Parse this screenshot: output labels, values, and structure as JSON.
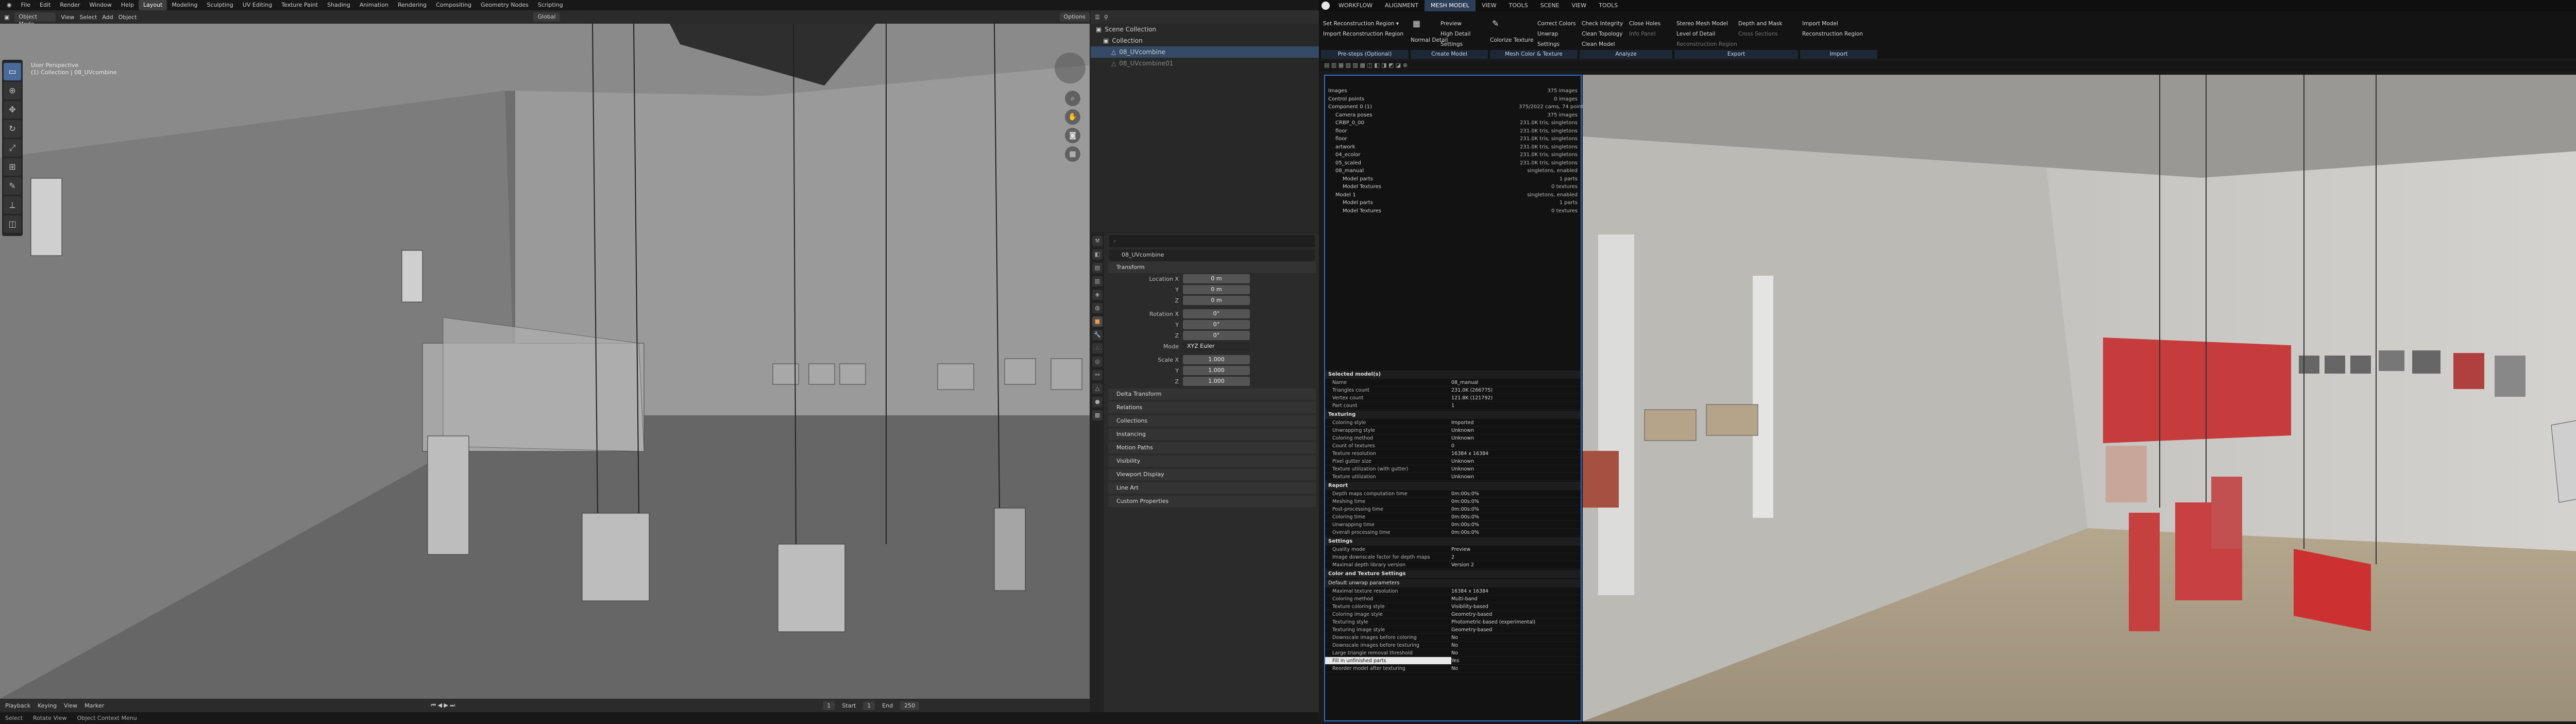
{
  "blender": {
    "topbar": {
      "menus": [
        "File",
        "Edit",
        "Render",
        "Window",
        "Help"
      ],
      "workspaces": [
        "Layout",
        "Modeling",
        "Sculpting",
        "UV Editing",
        "Texture Paint",
        "Shading",
        "Animation",
        "Rendering",
        "Compositing",
        "Geometry Nodes",
        "Scripting"
      ],
      "active_workspace": "Layout"
    },
    "viewport": {
      "orientation": "Global",
      "mode": "Object Mode",
      "menus": [
        "View",
        "Select",
        "Add",
        "Object"
      ],
      "options": "Options",
      "info_line1": "User Perspective",
      "info_line2": "(1) Collection | 08_UVcombine"
    },
    "timeline": {
      "menus": [
        "Playback",
        "Keying",
        "View",
        "Marker"
      ],
      "current_frame": "1",
      "start_label": "Start",
      "start": "1",
      "end_label": "End",
      "end": "250"
    },
    "statusbar": [
      "Select",
      "Rotate View",
      "Object Context Menu"
    ],
    "outliner": {
      "rows": [
        "Scene Collection",
        "Collection",
        "08_UVcombine",
        "08_UVcombine01"
      ]
    },
    "properties": {
      "object_name": "08_UVcombine",
      "transform": "Transform",
      "location_label": "Location X",
      "location": [
        "0 m",
        "0 m",
        "0 m"
      ],
      "rotation_label": "Rotation X",
      "rotation": [
        "0°",
        "0°",
        "0°"
      ],
      "mode_label": "Mode",
      "mode": "XYZ Euler",
      "scale_label": "Scale X",
      "scale": [
        "1.000",
        "1.000",
        "1.000"
      ],
      "axis": [
        "Y",
        "Z"
      ],
      "panels": [
        "Delta Transform",
        "Relations",
        "Collections",
        "Instancing",
        "Motion Paths",
        "Visibility",
        "Viewport Display",
        "Line Art",
        "Custom Properties"
      ]
    }
  },
  "rc": {
    "menubar": [
      "WORKFLOW",
      "ALIGNMENT",
      "MESH MODEL",
      "VIEW",
      "TOOLS",
      "SCENE",
      "VIEW",
      "TOOLS"
    ],
    "active_tab": "MESH MODEL",
    "ribbon": {
      "pre": {
        "items": [
          "Set Reconstruction Region ▾",
          "Import Reconstruction Region"
        ],
        "label": "Pre-steps (Optional)"
      },
      "create": {
        "items": [
          "Normal Detail",
          "Preview",
          "High Detail",
          "Settings"
        ],
        "label": "Create Model"
      },
      "mesh": {
        "items": [
          "Colorize",
          "Texture",
          "Correct Colors",
          "Unwrap",
          "Settings"
        ],
        "label": "Mesh Color & Texture"
      },
      "analyze": {
        "items": [
          "Check Integrity",
          "Close Holes",
          "Clean Topology",
          "Info Panel",
          "Clean Model"
        ],
        "label": "Analyze"
      },
      "export": {
        "items": [
          "Stereo Mesh Model",
          "Level of Detail",
          "Reconstruction Region",
          "Depth and Mask",
          "Cross Sections"
        ],
        "label": "Export"
      },
      "import": {
        "items": [
          "Import Model",
          "Reconstruction Region"
        ],
        "label": "Import"
      }
    },
    "tree": [
      {
        "n": "Images",
        "v": "375 images"
      },
      {
        "n": "Control points",
        "v": "0 images"
      },
      {
        "n": "Component 0 (1)",
        "v": "375/2022 cams, 74 points"
      },
      {
        "n": "Camera poses",
        "v": "375 images"
      },
      {
        "n": "CRBP_0_00",
        "v": "231.0K tris, singletons"
      },
      {
        "n": "floor",
        "v": "231.0K tris, singletons"
      },
      {
        "n": "floor",
        "v": "231.0K tris, singletons"
      },
      {
        "n": "artwork",
        "v": "231.0K tris, singletons"
      },
      {
        "n": "04_ecolor",
        "v": "231.0K tris, singletons"
      },
      {
        "n": "05_scaled",
        "v": "231.0K tris, singletons"
      },
      {
        "n": "08_manual",
        "v": "singletons, enabled"
      },
      {
        "n": "Model parts",
        "v": "1 parts"
      },
      {
        "n": "Model Textures",
        "v": "0 textures"
      },
      {
        "n": "Model 1",
        "v": "singletons, enabled"
      },
      {
        "n": "Model parts",
        "v": "1 parts"
      },
      {
        "n": "Model Textures",
        "v": "0 textures"
      }
    ],
    "selected": {
      "title": "Selected model(s)",
      "rows": [
        [
          "Name",
          "08_manual"
        ],
        [
          "Triangles count",
          "231.0K (266775)"
        ],
        [
          "Vertex count",
          "121.8K (121792)"
        ],
        [
          "Part count",
          "1"
        ]
      ]
    },
    "texturing": {
      "title": "Texturing",
      "rows": [
        [
          "Coloring style",
          "Imported"
        ],
        [
          "Unwrapping style",
          "Unknown"
        ],
        [
          "Coloring method",
          "Unknown"
        ],
        [
          "Count of textures",
          "0"
        ],
        [
          "Texture resolution",
          "16384 x 16384"
        ],
        [
          "Pixel gutter size",
          "Unknown"
        ],
        [
          "Texture utilization (with gutter)",
          "Unknown"
        ],
        [
          "Texture utilization",
          "Unknown"
        ]
      ]
    },
    "report": {
      "title": "Report",
      "rows": [
        [
          "Depth maps computation time",
          "0m:00s:0%"
        ],
        [
          "Meshing time",
          "0m:00s:0%"
        ],
        [
          "Post-processing time",
          "0m:00s:0%"
        ],
        [
          "Coloring time",
          "0m:00s:0%"
        ],
        [
          "Unwrapping time",
          "0m:00s:0%"
        ],
        [
          "Overall processing time",
          "0m:00s:0%"
        ]
      ]
    },
    "settings": {
      "title": "Settings",
      "rows": [
        [
          "Quality mode",
          "Preview"
        ],
        [
          "Image downscale factor for depth maps",
          "2"
        ],
        [
          "Maximal depth library version",
          "Version 2"
        ]
      ]
    },
    "color_tex": {
      "title": "Color and Texture Settings",
      "sub": "Default unwrap parameters",
      "rows": [
        [
          "Maximal texture resolution",
          "16384 x 16384"
        ],
        [
          "Coloring method",
          "Multi-band"
        ],
        [
          "Texture coloring style",
          "Visibility-based"
        ],
        [
          "Coloring image style",
          "Geometry-based"
        ],
        [
          "Texturing style",
          "Photometric-based (experimental)"
        ],
        [
          "Texturing image style",
          "Geometry-based"
        ],
        [
          "Downscale images before coloring",
          "No"
        ],
        [
          "Downscale images before texturing",
          "No"
        ],
        [
          "Large triangle removal threshold",
          "No"
        ],
        [
          "Fill in unfinished parts",
          "Yes"
        ],
        [
          "Reorder model after texturing",
          "No"
        ]
      ]
    }
  }
}
